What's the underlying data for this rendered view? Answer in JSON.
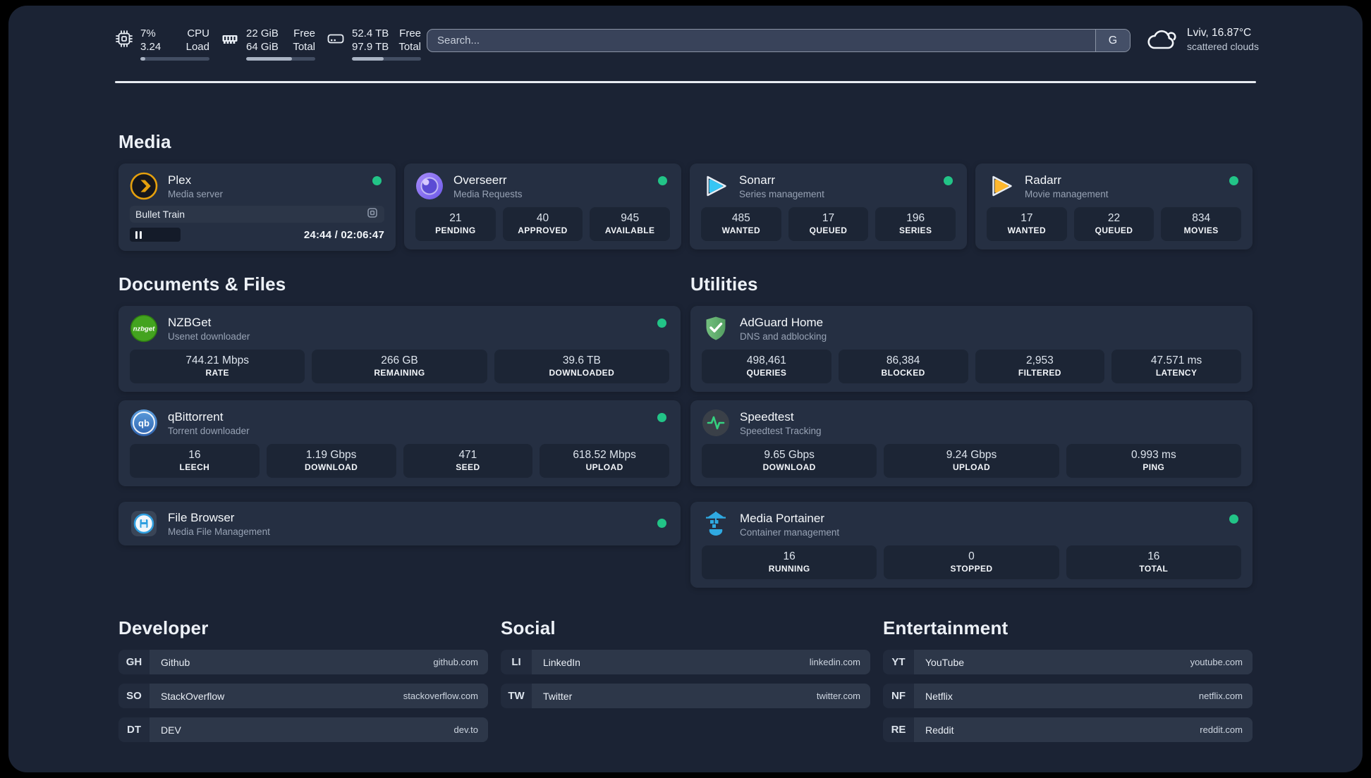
{
  "colors": {
    "page-bg": "#000000",
    "panel-bg": "#1b2334",
    "card-bg": "#252f42",
    "tile-bg": "#1c2535",
    "status-green": "#22c487",
    "text-primary": "#eef2f7",
    "text-muted": "#97a2b4"
  },
  "topbar": {
    "resources": [
      {
        "icon": "cpu-icon",
        "values": [
          "7%",
          "3.24"
        ],
        "labels": [
          "CPU",
          "Load"
        ],
        "progress": 7
      },
      {
        "icon": "memory-icon",
        "values": [
          "22 GiB",
          "64 GiB"
        ],
        "labels": [
          "Free",
          "Total"
        ],
        "progress": 66
      },
      {
        "icon": "disk-icon",
        "values": [
          "52.4 TB",
          "97.9 TB"
        ],
        "labels": [
          "Free",
          "Total"
        ],
        "progress": 46
      }
    ],
    "search": {
      "placeholder": "Search...",
      "button_label": "G"
    },
    "weather": {
      "location": "Lviv, 16.87°C",
      "condition": "scattered clouds"
    }
  },
  "media": {
    "section_title": "Media",
    "plex": {
      "name": "Plex",
      "desc": "Media server",
      "status": "online",
      "player_title": "Bullet Train",
      "player_time": "24:44 / 02:06:47"
    },
    "overseerr": {
      "name": "Overseerr",
      "desc": "Media Requests",
      "status": "online",
      "stats": [
        {
          "value": "21",
          "label": "PENDING"
        },
        {
          "value": "40",
          "label": "APPROVED"
        },
        {
          "value": "945",
          "label": "AVAILABLE"
        }
      ]
    },
    "sonarr": {
      "name": "Sonarr",
      "desc": "Series management",
      "status": "online",
      "stats": [
        {
          "value": "485",
          "label": "WANTED"
        },
        {
          "value": "17",
          "label": "QUEUED"
        },
        {
          "value": "196",
          "label": "SERIES"
        }
      ]
    },
    "radarr": {
      "name": "Radarr",
      "desc": "Movie management",
      "status": "online",
      "stats": [
        {
          "value": "17",
          "label": "WANTED"
        },
        {
          "value": "22",
          "label": "QUEUED"
        },
        {
          "value": "834",
          "label": "MOVIES"
        }
      ]
    }
  },
  "documents": {
    "section_title": "Documents & Files",
    "nzbget": {
      "name": "NZBGet",
      "desc": "Usenet downloader",
      "status": "online",
      "stats": [
        {
          "value": "744.21 Mbps",
          "label": "RATE"
        },
        {
          "value": "266 GB",
          "label": "REMAINING"
        },
        {
          "value": "39.6 TB",
          "label": "DOWNLOADED"
        }
      ]
    },
    "qbittorrent": {
      "name": "qBittorrent",
      "desc": "Torrent downloader",
      "status": "online",
      "stats": [
        {
          "value": "16",
          "label": "LEECH"
        },
        {
          "value": "1.19 Gbps",
          "label": "DOWNLOAD"
        },
        {
          "value": "471",
          "label": "SEED"
        },
        {
          "value": "618.52 Mbps",
          "label": "UPLOAD"
        }
      ]
    },
    "filebrowser": {
      "name": "File Browser",
      "desc": "Media File Management",
      "status": "online"
    }
  },
  "utilities": {
    "section_title": "Utilities",
    "adguard": {
      "name": "AdGuard Home",
      "desc": "DNS and adblocking",
      "stats": [
        {
          "value": "498,461",
          "label": "QUERIES"
        },
        {
          "value": "86,384",
          "label": "BLOCKED"
        },
        {
          "value": "2,953",
          "label": "FILTERED"
        },
        {
          "value": "47.571 ms",
          "label": "LATENCY"
        }
      ]
    },
    "speedtest": {
      "name": "Speedtest",
      "desc": "Speedtest Tracking",
      "stats": [
        {
          "value": "9.65 Gbps",
          "label": "DOWNLOAD"
        },
        {
          "value": "9.24 Gbps",
          "label": "UPLOAD"
        },
        {
          "value": "0.993 ms",
          "label": "PING"
        }
      ]
    },
    "portainer": {
      "name": "Media Portainer",
      "desc": "Container management",
      "status": "online",
      "stats": [
        {
          "value": "16",
          "label": "RUNNING"
        },
        {
          "value": "0",
          "label": "STOPPED"
        },
        {
          "value": "16",
          "label": "TOTAL"
        }
      ]
    }
  },
  "bookmarks": {
    "developer": {
      "section_title": "Developer",
      "links": [
        {
          "abbr": "GH",
          "name": "Github",
          "url": "github.com"
        },
        {
          "abbr": "SO",
          "name": "StackOverflow",
          "url": "stackoverflow.com"
        },
        {
          "abbr": "DT",
          "name": "DEV",
          "url": "dev.to"
        }
      ]
    },
    "social": {
      "section_title": "Social",
      "links": [
        {
          "abbr": "LI",
          "name": "LinkedIn",
          "url": "linkedin.com"
        },
        {
          "abbr": "TW",
          "name": "Twitter",
          "url": "twitter.com"
        }
      ]
    },
    "entertainment": {
      "section_title": "Entertainment",
      "links": [
        {
          "abbr": "YT",
          "name": "YouTube",
          "url": "youtube.com"
        },
        {
          "abbr": "NF",
          "name": "Netflix",
          "url": "netflix.com"
        },
        {
          "abbr": "RE",
          "name": "Reddit",
          "url": "reddit.com"
        }
      ]
    }
  }
}
